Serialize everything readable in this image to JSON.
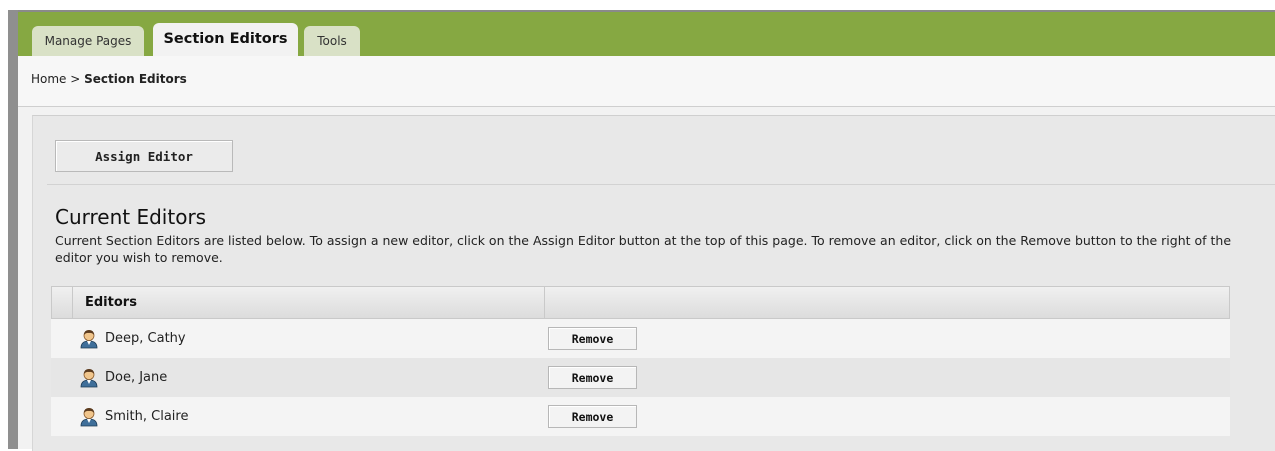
{
  "tabs": [
    {
      "label": "Manage Pages"
    },
    {
      "label": "Section Editors"
    },
    {
      "label": "Tools"
    }
  ],
  "breadcrumb": {
    "home": "Home",
    "separator": " > ",
    "current": "Section Editors"
  },
  "toolbar": {
    "assign_label": "Assign Editor"
  },
  "section": {
    "title": "Current Editors",
    "description": "Current Section Editors are listed below. To assign a new editor, click on the Assign Editor button at the top of this page. To remove an editor, click on the Remove button to the right of the editor you wish to remove."
  },
  "table": {
    "header": "Editors",
    "rows": [
      {
        "name": "Deep, Cathy",
        "action": "Remove"
      },
      {
        "name": "Doe, Jane",
        "action": "Remove"
      },
      {
        "name": "Smith, Claire",
        "action": "Remove"
      }
    ]
  },
  "colors": {
    "tabbar": "#86a842",
    "tab_inactive": "#d9e1c6",
    "panel": "#e8e8e8"
  },
  "icons": {
    "editor": "user-person-icon"
  }
}
